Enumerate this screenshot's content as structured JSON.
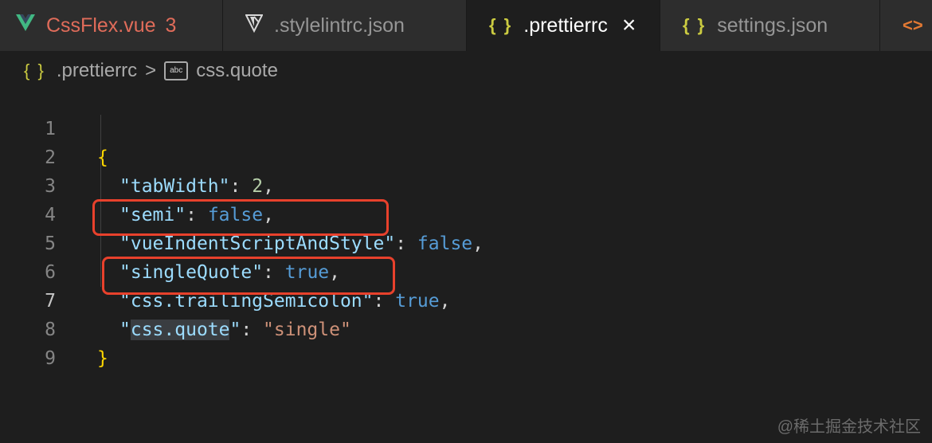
{
  "tabs": [
    {
      "label": "CssFlex.vue",
      "badge": "3",
      "icon": "vue-icon"
    },
    {
      "label": ".stylelintrc.json",
      "icon": "stylelint-icon"
    },
    {
      "label": ".prettierrc",
      "icon": "json-braces-icon",
      "close": "×",
      "active": true
    },
    {
      "label": "settings.json",
      "icon": "json-braces-icon"
    },
    {
      "label": "",
      "icon": "code-icon"
    }
  ],
  "icons": {
    "braces": "{ }",
    "code": "<>",
    "abc": "abc"
  },
  "breadcrumb": {
    "file": ".prettierrc",
    "separator": ">",
    "symbol": "css.quote"
  },
  "line_numbers": [
    "1",
    "2",
    "3",
    "4",
    "5",
    "6",
    "7",
    "8",
    "9"
  ],
  "code": {
    "open_brace": "{",
    "close_brace": "}",
    "lines": [
      {
        "key": "tabWidth",
        "value": "2"
      },
      {
        "key": "semi",
        "value": "false"
      },
      {
        "key": "vueIndentScriptAndStyle",
        "value": "false"
      },
      {
        "key": "singleQuote",
        "value": "true"
      },
      {
        "key": "css.trailingSemicolon",
        "value": "true"
      },
      {
        "key": "css.quote",
        "value": "\"single\""
      }
    ]
  },
  "colors": {
    "annotation": "#e8412c",
    "string": "#ce9178",
    "key": "#9cdcfe",
    "boolean": "#569cd6",
    "number": "#b5cea8",
    "brace": "#ffd700"
  },
  "watermark": "@稀土掘金技术社区"
}
